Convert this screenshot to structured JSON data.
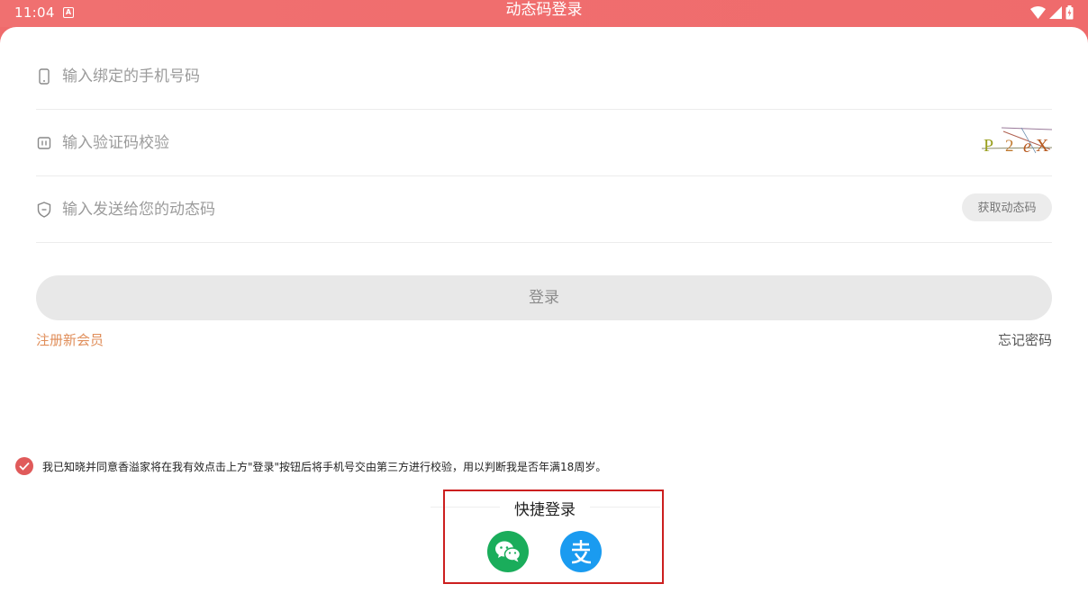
{
  "status_bar": {
    "time": "11:04",
    "notification_icon": "A",
    "title": "动态码登录"
  },
  "form": {
    "phone_placeholder": "输入绑定的手机号码",
    "captcha_placeholder": "输入验证码校验",
    "captcha_text": "P 2 e X",
    "code_placeholder": "输入发送给您的动态码",
    "get_code_label": "获取动态码"
  },
  "login_button_label": "登录",
  "register_label": "注册新会员",
  "forgot_label": "忘记密码",
  "agreement_text": "我已知晓并同意香溢家将在我有效点击上方\"登录\"按钮后将手机号交由第三方进行校验，用以判断我是否年满18周岁。",
  "quick_login": {
    "title": "快捷登录",
    "options": [
      "wechat-icon",
      "alipay-icon"
    ]
  },
  "colors": {
    "header": "#ef6b6c",
    "accent_text": "#e08e5a",
    "wechat": "#1aad5b",
    "alipay": "#1a9bf0",
    "highlight_box": "#cc1f1f"
  }
}
